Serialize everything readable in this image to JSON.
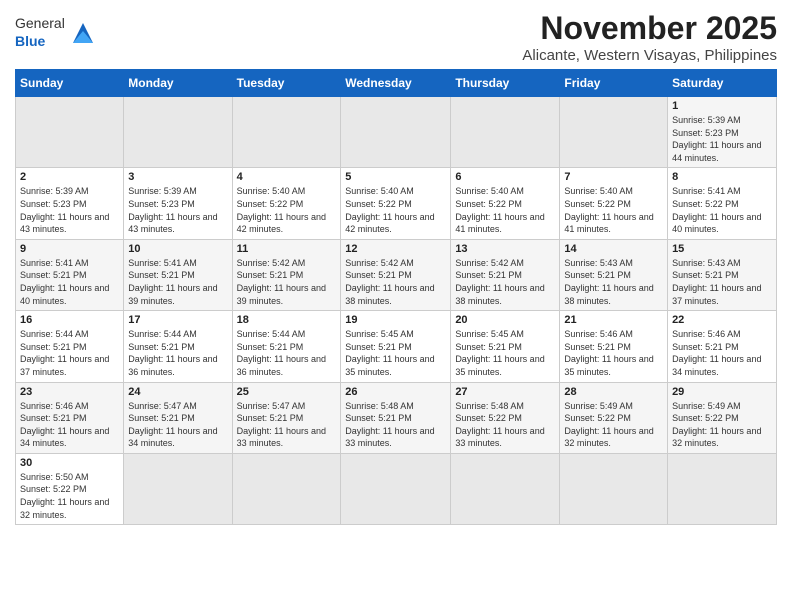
{
  "header": {
    "logo_general": "General",
    "logo_blue": "Blue",
    "month_title": "November 2025",
    "location": "Alicante, Western Visayas, Philippines"
  },
  "days_of_week": [
    "Sunday",
    "Monday",
    "Tuesday",
    "Wednesday",
    "Thursday",
    "Friday",
    "Saturday"
  ],
  "weeks": [
    [
      {
        "day": "",
        "sunrise": "",
        "sunset": "",
        "daylight": "",
        "empty": true
      },
      {
        "day": "",
        "sunrise": "",
        "sunset": "",
        "daylight": "",
        "empty": true
      },
      {
        "day": "",
        "sunrise": "",
        "sunset": "",
        "daylight": "",
        "empty": true
      },
      {
        "day": "",
        "sunrise": "",
        "sunset": "",
        "daylight": "",
        "empty": true
      },
      {
        "day": "",
        "sunrise": "",
        "sunset": "",
        "daylight": "",
        "empty": true
      },
      {
        "day": "",
        "sunrise": "",
        "sunset": "",
        "daylight": "",
        "empty": true
      },
      {
        "day": "1",
        "sunrise": "Sunrise: 5:39 AM",
        "sunset": "Sunset: 5:23 PM",
        "daylight": "Daylight: 11 hours and 44 minutes.",
        "empty": false
      }
    ],
    [
      {
        "day": "2",
        "sunrise": "Sunrise: 5:39 AM",
        "sunset": "Sunset: 5:23 PM",
        "daylight": "Daylight: 11 hours and 43 minutes.",
        "empty": false
      },
      {
        "day": "3",
        "sunrise": "Sunrise: 5:39 AM",
        "sunset": "Sunset: 5:23 PM",
        "daylight": "Daylight: 11 hours and 43 minutes.",
        "empty": false
      },
      {
        "day": "4",
        "sunrise": "Sunrise: 5:40 AM",
        "sunset": "Sunset: 5:22 PM",
        "daylight": "Daylight: 11 hours and 42 minutes.",
        "empty": false
      },
      {
        "day": "5",
        "sunrise": "Sunrise: 5:40 AM",
        "sunset": "Sunset: 5:22 PM",
        "daylight": "Daylight: 11 hours and 42 minutes.",
        "empty": false
      },
      {
        "day": "6",
        "sunrise": "Sunrise: 5:40 AM",
        "sunset": "Sunset: 5:22 PM",
        "daylight": "Daylight: 11 hours and 41 minutes.",
        "empty": false
      },
      {
        "day": "7",
        "sunrise": "Sunrise: 5:40 AM",
        "sunset": "Sunset: 5:22 PM",
        "daylight": "Daylight: 11 hours and 41 minutes.",
        "empty": false
      },
      {
        "day": "8",
        "sunrise": "Sunrise: 5:41 AM",
        "sunset": "Sunset: 5:22 PM",
        "daylight": "Daylight: 11 hours and 40 minutes.",
        "empty": false
      }
    ],
    [
      {
        "day": "9",
        "sunrise": "Sunrise: 5:41 AM",
        "sunset": "Sunset: 5:21 PM",
        "daylight": "Daylight: 11 hours and 40 minutes.",
        "empty": false
      },
      {
        "day": "10",
        "sunrise": "Sunrise: 5:41 AM",
        "sunset": "Sunset: 5:21 PM",
        "daylight": "Daylight: 11 hours and 39 minutes.",
        "empty": false
      },
      {
        "day": "11",
        "sunrise": "Sunrise: 5:42 AM",
        "sunset": "Sunset: 5:21 PM",
        "daylight": "Daylight: 11 hours and 39 minutes.",
        "empty": false
      },
      {
        "day": "12",
        "sunrise": "Sunrise: 5:42 AM",
        "sunset": "Sunset: 5:21 PM",
        "daylight": "Daylight: 11 hours and 38 minutes.",
        "empty": false
      },
      {
        "day": "13",
        "sunrise": "Sunrise: 5:42 AM",
        "sunset": "Sunset: 5:21 PM",
        "daylight": "Daylight: 11 hours and 38 minutes.",
        "empty": false
      },
      {
        "day": "14",
        "sunrise": "Sunrise: 5:43 AM",
        "sunset": "Sunset: 5:21 PM",
        "daylight": "Daylight: 11 hours and 38 minutes.",
        "empty": false
      },
      {
        "day": "15",
        "sunrise": "Sunrise: 5:43 AM",
        "sunset": "Sunset: 5:21 PM",
        "daylight": "Daylight: 11 hours and 37 minutes.",
        "empty": false
      }
    ],
    [
      {
        "day": "16",
        "sunrise": "Sunrise: 5:44 AM",
        "sunset": "Sunset: 5:21 PM",
        "daylight": "Daylight: 11 hours and 37 minutes.",
        "empty": false
      },
      {
        "day": "17",
        "sunrise": "Sunrise: 5:44 AM",
        "sunset": "Sunset: 5:21 PM",
        "daylight": "Daylight: 11 hours and 36 minutes.",
        "empty": false
      },
      {
        "day": "18",
        "sunrise": "Sunrise: 5:44 AM",
        "sunset": "Sunset: 5:21 PM",
        "daylight": "Daylight: 11 hours and 36 minutes.",
        "empty": false
      },
      {
        "day": "19",
        "sunrise": "Sunrise: 5:45 AM",
        "sunset": "Sunset: 5:21 PM",
        "daylight": "Daylight: 11 hours and 35 minutes.",
        "empty": false
      },
      {
        "day": "20",
        "sunrise": "Sunrise: 5:45 AM",
        "sunset": "Sunset: 5:21 PM",
        "daylight": "Daylight: 11 hours and 35 minutes.",
        "empty": false
      },
      {
        "day": "21",
        "sunrise": "Sunrise: 5:46 AM",
        "sunset": "Sunset: 5:21 PM",
        "daylight": "Daylight: 11 hours and 35 minutes.",
        "empty": false
      },
      {
        "day": "22",
        "sunrise": "Sunrise: 5:46 AM",
        "sunset": "Sunset: 5:21 PM",
        "daylight": "Daylight: 11 hours and 34 minutes.",
        "empty": false
      }
    ],
    [
      {
        "day": "23",
        "sunrise": "Sunrise: 5:46 AM",
        "sunset": "Sunset: 5:21 PM",
        "daylight": "Daylight: 11 hours and 34 minutes.",
        "empty": false
      },
      {
        "day": "24",
        "sunrise": "Sunrise: 5:47 AM",
        "sunset": "Sunset: 5:21 PM",
        "daylight": "Daylight: 11 hours and 34 minutes.",
        "empty": false
      },
      {
        "day": "25",
        "sunrise": "Sunrise: 5:47 AM",
        "sunset": "Sunset: 5:21 PM",
        "daylight": "Daylight: 11 hours and 33 minutes.",
        "empty": false
      },
      {
        "day": "26",
        "sunrise": "Sunrise: 5:48 AM",
        "sunset": "Sunset: 5:21 PM",
        "daylight": "Daylight: 11 hours and 33 minutes.",
        "empty": false
      },
      {
        "day": "27",
        "sunrise": "Sunrise: 5:48 AM",
        "sunset": "Sunset: 5:22 PM",
        "daylight": "Daylight: 11 hours and 33 minutes.",
        "empty": false
      },
      {
        "day": "28",
        "sunrise": "Sunrise: 5:49 AM",
        "sunset": "Sunset: 5:22 PM",
        "daylight": "Daylight: 11 hours and 32 minutes.",
        "empty": false
      },
      {
        "day": "29",
        "sunrise": "Sunrise: 5:49 AM",
        "sunset": "Sunset: 5:22 PM",
        "daylight": "Daylight: 11 hours and 32 minutes.",
        "empty": false
      }
    ],
    [
      {
        "day": "30",
        "sunrise": "Sunrise: 5:50 AM",
        "sunset": "Sunset: 5:22 PM",
        "daylight": "Daylight: 11 hours and 32 minutes.",
        "empty": false
      },
      {
        "day": "",
        "sunrise": "",
        "sunset": "",
        "daylight": "",
        "empty": true
      },
      {
        "day": "",
        "sunrise": "",
        "sunset": "",
        "daylight": "",
        "empty": true
      },
      {
        "day": "",
        "sunrise": "",
        "sunset": "",
        "daylight": "",
        "empty": true
      },
      {
        "day": "",
        "sunrise": "",
        "sunset": "",
        "daylight": "",
        "empty": true
      },
      {
        "day": "",
        "sunrise": "",
        "sunset": "",
        "daylight": "",
        "empty": true
      },
      {
        "day": "",
        "sunrise": "",
        "sunset": "",
        "daylight": "",
        "empty": true
      }
    ]
  ]
}
